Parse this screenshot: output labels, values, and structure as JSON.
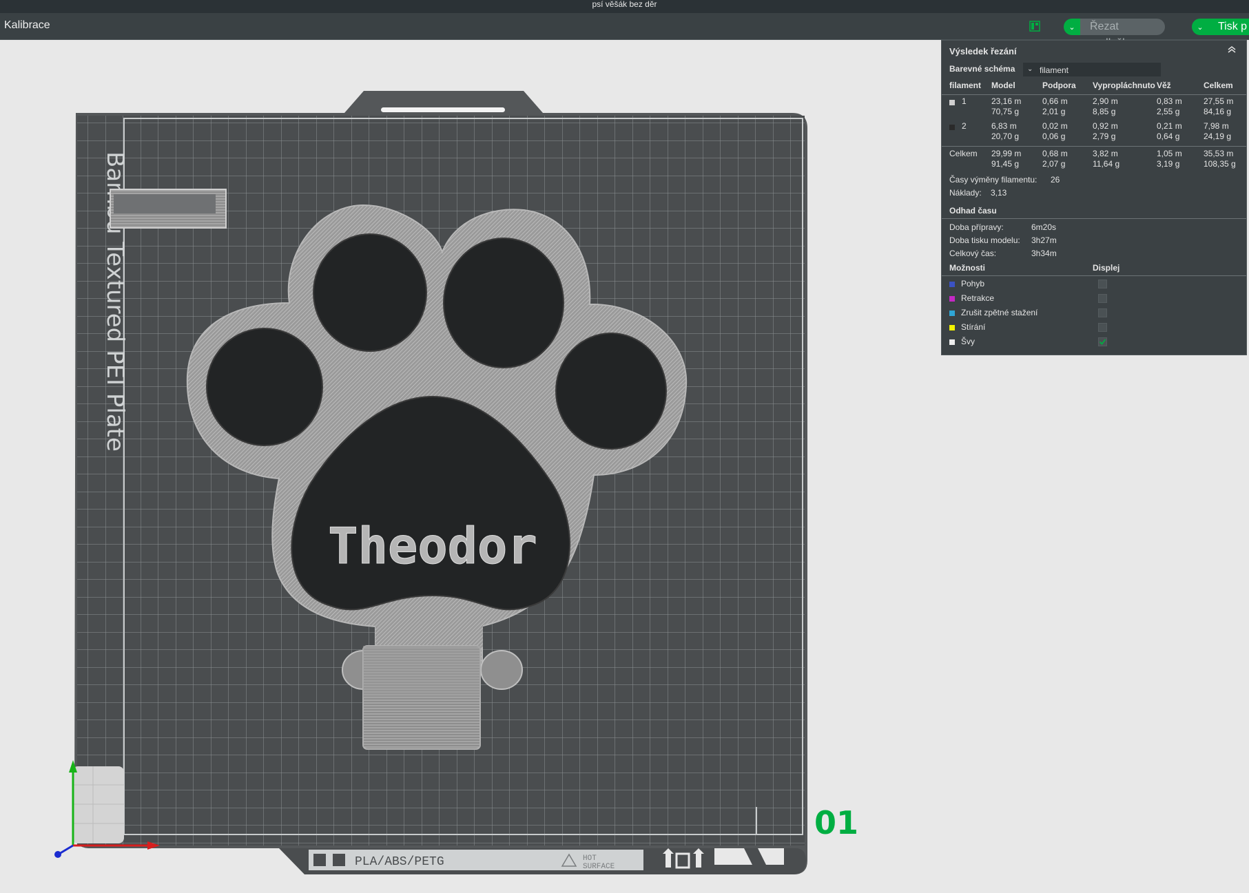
{
  "window": {
    "title": "psí věšák bez děr"
  },
  "toolbar": {
    "menu_label": "Kalibrace",
    "layout_icon": "layout-icon",
    "slice_button": "Řezat podložku",
    "print_button": "Tisk p"
  },
  "scene": {
    "plate_text": "Bambu Textured PEI Plate",
    "model_text": "Theodor",
    "plate_footer_text": "PLA/ABS/PETG",
    "hot_surface_1": "HOT",
    "hot_surface_2": "SURFACE",
    "plate_number": "01"
  },
  "panel": {
    "title": "Výsledek řezání",
    "collapse_icon": "double-chevron-up-icon",
    "color_scheme_label": "Barevné schéma",
    "color_scheme_value": "filament",
    "columns": [
      "filament",
      "Model",
      "Podpora",
      "Vypropláchnuto",
      "Věž",
      "Celkem"
    ],
    "rows": [
      {
        "id": "1",
        "color": "#d0d0d0",
        "model": "23,16 m\n70,75 g",
        "support": "0,66 m\n2,01 g",
        "flushed": "2,90 m\n8,85 g",
        "tower": "0,83 m\n2,55 g",
        "total": "27,55 m\n84,16 g"
      },
      {
        "id": "2",
        "color": "#2a2a2a",
        "model": "6,83 m\n20,70 g",
        "support": "0,02 m\n0,06 g",
        "flushed": "0,92 m\n2,79 g",
        "tower": "0,21 m\n0,64 g",
        "total": "7,98 m\n24,19 g"
      }
    ],
    "total_row": {
      "label": "Celkem",
      "model": "29,99 m\n91,45 g",
      "support": "0,68 m\n2,07 g",
      "flushed": "3,82 m\n11,64 g",
      "tower": "1,05 m\n3,19 g",
      "total": "35,53 m\n108,35 g"
    },
    "filament_changes_label": "Časy výměny filamentu:",
    "filament_changes_value": "26",
    "cost_label": "Náklady:",
    "cost_value": "3,13",
    "time_section": "Odhad času",
    "prep_label": "Doba přípravy:",
    "prep_value": "6m20s",
    "model_time_label": "Doba tisku modelu:",
    "model_time_value": "3h27m",
    "total_time_label": "Celkový čas:",
    "total_time_value": "3h34m",
    "options_header": "Možnosti",
    "display_header": "Displej",
    "options": [
      {
        "label": "Pohyb",
        "color": "#3b52c4",
        "checked": false
      },
      {
        "label": "Retrakce",
        "color": "#c429c4",
        "checked": false
      },
      {
        "label": "Zrušit zpětné stažení",
        "color": "#2fa6d6",
        "checked": false
      },
      {
        "label": "Stírání",
        "color": "#f2f200",
        "checked": false
      },
      {
        "label": "Švy",
        "color": "#ededed",
        "checked": true
      }
    ]
  }
}
